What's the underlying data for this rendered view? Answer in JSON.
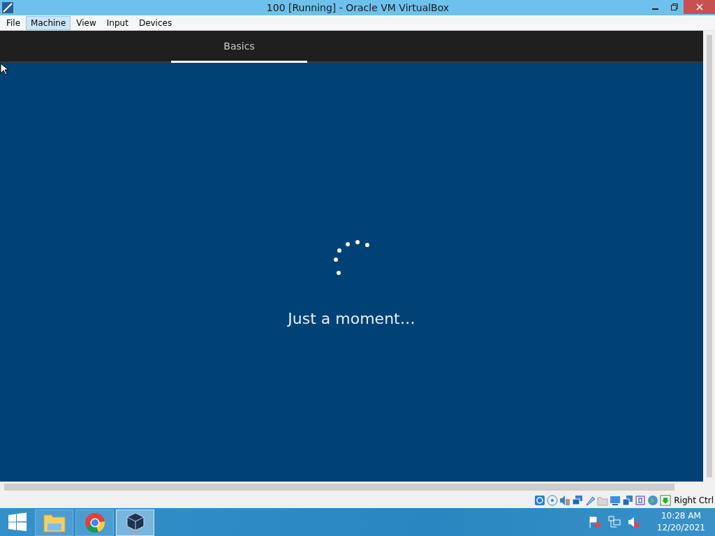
{
  "window": {
    "title": "100 [Running] - Oracle VM VirtualBox"
  },
  "menu": [
    {
      "label": "File",
      "selected": false
    },
    {
      "label": "Machine",
      "selected": true
    },
    {
      "label": "View",
      "selected": false
    },
    {
      "label": "Input",
      "selected": false
    },
    {
      "label": "Devices",
      "selected": false
    }
  ],
  "guest": {
    "tabs": [
      {
        "label": "Basics",
        "selected": true
      }
    ],
    "message": "Just a moment…"
  },
  "status_bar": {
    "host_key": "Right Ctrl"
  },
  "taskbar": {
    "apps": [
      {
        "kind": "explorer",
        "selected": false
      },
      {
        "kind": "chrome",
        "selected": false
      },
      {
        "kind": "virtualbox",
        "selected": true
      }
    ],
    "time": "10:28 AM",
    "date": "12/20/2021"
  }
}
